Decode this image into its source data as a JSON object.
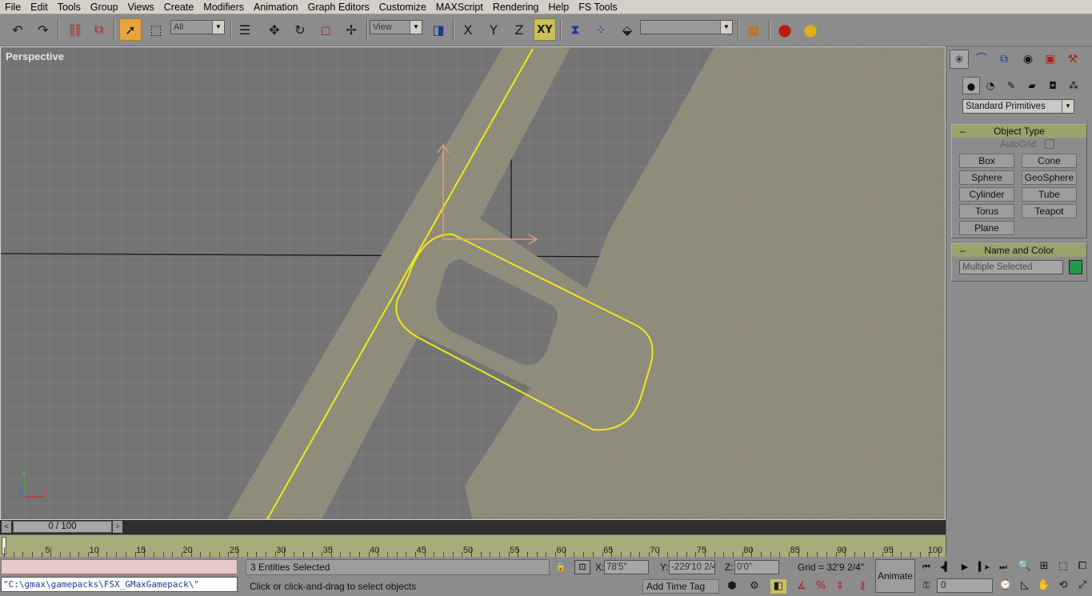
{
  "menu": [
    "File",
    "Edit",
    "Tools",
    "Group",
    "Views",
    "Create",
    "Modifiers",
    "Animation",
    "Graph Editors",
    "Customize",
    "MAXScript",
    "Rendering",
    "Help",
    "FS Tools"
  ],
  "toolbar": {
    "selection_filter": "All",
    "ref_coord": "View",
    "named_selection": "",
    "constraint_x": "X",
    "constraint_y": "Y",
    "constraint_z": "Z",
    "constraint_xy": "XY"
  },
  "viewport": {
    "label": "Perspective",
    "axis_y": "Y",
    "axis_x": "X",
    "axis_z": "Z",
    "colors": {
      "background": "#747474",
      "terrain": "#8f8c80",
      "spline": "#f0e81a",
      "gizmo": "#f0a07a"
    }
  },
  "time_slider": {
    "label": "0 / 100",
    "prev": "<",
    "next": ">"
  },
  "trackbar": {
    "labels": [
      "5",
      "10",
      "15",
      "20",
      "25",
      "30",
      "35",
      "40",
      "45",
      "50",
      "55",
      "60",
      "65",
      "70",
      "75",
      "80",
      "85",
      "90",
      "95",
      "100"
    ]
  },
  "status": {
    "listener_output": "",
    "listener_input": "\"C:\\gmax\\gamepacks\\FSX_GMaxGamepack\\\"",
    "selection": "3 Entities Selected",
    "prompt": "Click or click-and-drag to select objects",
    "x_label": "X:",
    "x_value": "78'5\"",
    "y_label": "Y:",
    "y_value": "-229'10 2/4",
    "z_label": "Z:",
    "z_value": "0'0\"",
    "grid": "Grid = 32'9 2/4\"",
    "add_time_tag": "Add Time Tag",
    "animate": "Animate",
    "frame": "0"
  },
  "command_panel": {
    "primitive_type": "Standard Primitives",
    "object_type_title": "Object Type",
    "autogrid": "AutoGrid",
    "buttons": [
      "Box",
      "Cone",
      "Sphere",
      "GeoSphere",
      "Cylinder",
      "Tube",
      "Torus",
      "Teapot",
      "Plane"
    ],
    "name_color_title": "Name and Color",
    "name_value": "Multiple Selected",
    "color": "#1f9a4a"
  }
}
